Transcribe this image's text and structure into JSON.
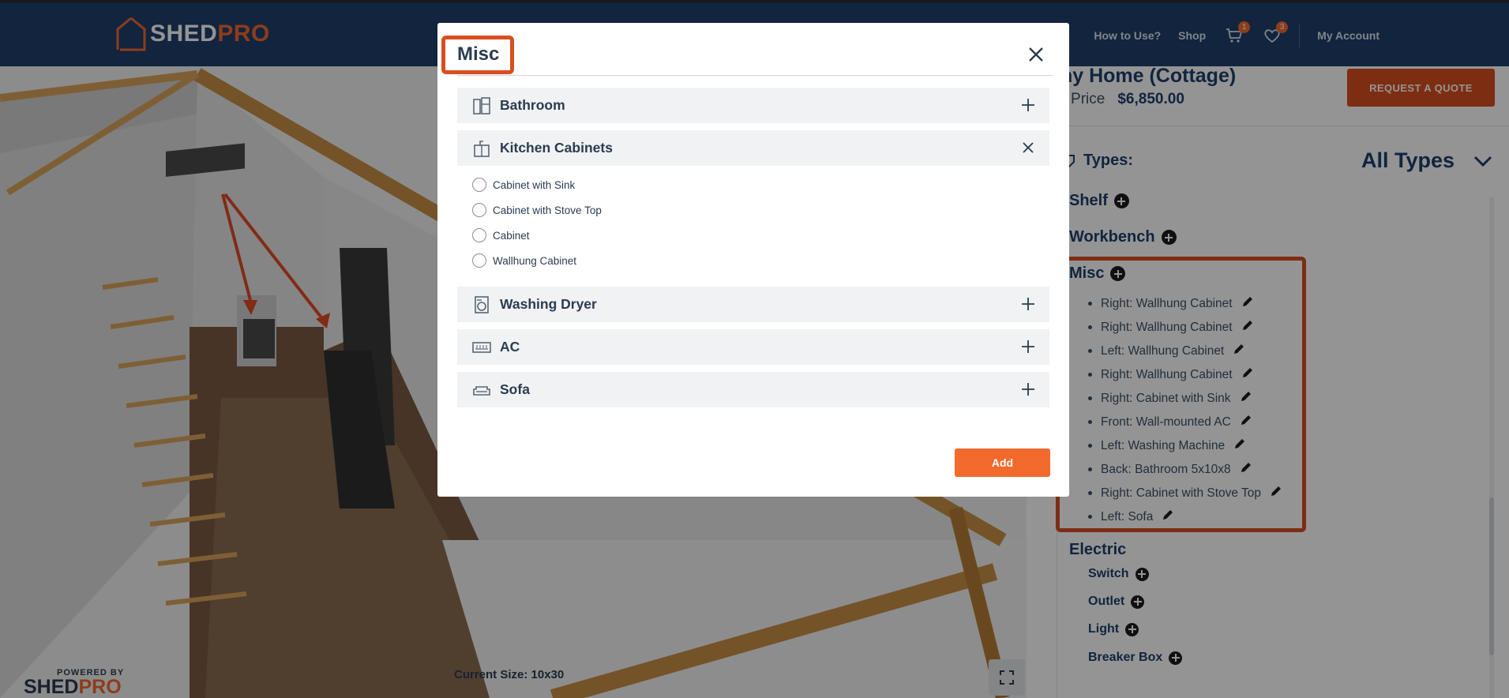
{
  "header": {
    "logo": {
      "word1": "SHED",
      "word2": "PRO"
    },
    "nav": {
      "how_to_use": "How to Use?",
      "shop": "Shop",
      "cart_count": "1",
      "wishlist_count": "3",
      "my_account": "My Account"
    }
  },
  "viewport": {
    "current_size_label": "Current Size: 10x30",
    "powered_by": "POWERED BY",
    "powered_logo_word1": "SHED",
    "powered_logo_word2": "PRO"
  },
  "panel": {
    "product_title": "iny Home (Cottage)",
    "price_label": "st Price",
    "price_value": "$6,850.00",
    "quote_button": "REQUEST A QUOTE",
    "types_label": "Types:",
    "types_value": "All Types",
    "categories": {
      "shelf": "Shelf",
      "workbench": "Workbench",
      "misc": "Misc",
      "electric": "Electric"
    },
    "misc_items": [
      "Right: Wallhung Cabinet",
      "Right: Wallhung Cabinet",
      "Left: Wallhung Cabinet",
      "Right: Wallhung Cabinet",
      "Right: Cabinet with Sink",
      "Front: Wall-mounted AC",
      "Left: Washing Machine",
      "Back: Bathroom 5x10x8",
      "Right: Cabinet with Stove Top",
      "Left: Sofa"
    ],
    "electric_items": [
      "Switch",
      "Outlet",
      "Light",
      "Breaker Box"
    ]
  },
  "modal": {
    "title": "Misc",
    "sections": [
      {
        "label": "Bathroom",
        "icon": "bathroom-icon",
        "expanded": false
      },
      {
        "label": "Kitchen Cabinets",
        "icon": "kitchen-cabinet-icon",
        "expanded": true
      },
      {
        "label": "Washing Dryer",
        "icon": "washing-machine-icon",
        "expanded": false
      },
      {
        "label": "AC",
        "icon": "ac-icon",
        "expanded": false
      },
      {
        "label": "Sofa",
        "icon": "sofa-icon",
        "expanded": false
      }
    ],
    "kitchen_options": [
      "Cabinet with Sink",
      "Cabinet with Stove Top",
      "Cabinet",
      "Wallhung Cabinet"
    ],
    "add_button": "Add"
  },
  "colors": {
    "header_bg": "#1f3f6b",
    "accent_orange": "#f36a2d",
    "highlight_red": "#d84f1f",
    "text_navy": "#1f3f6b"
  }
}
